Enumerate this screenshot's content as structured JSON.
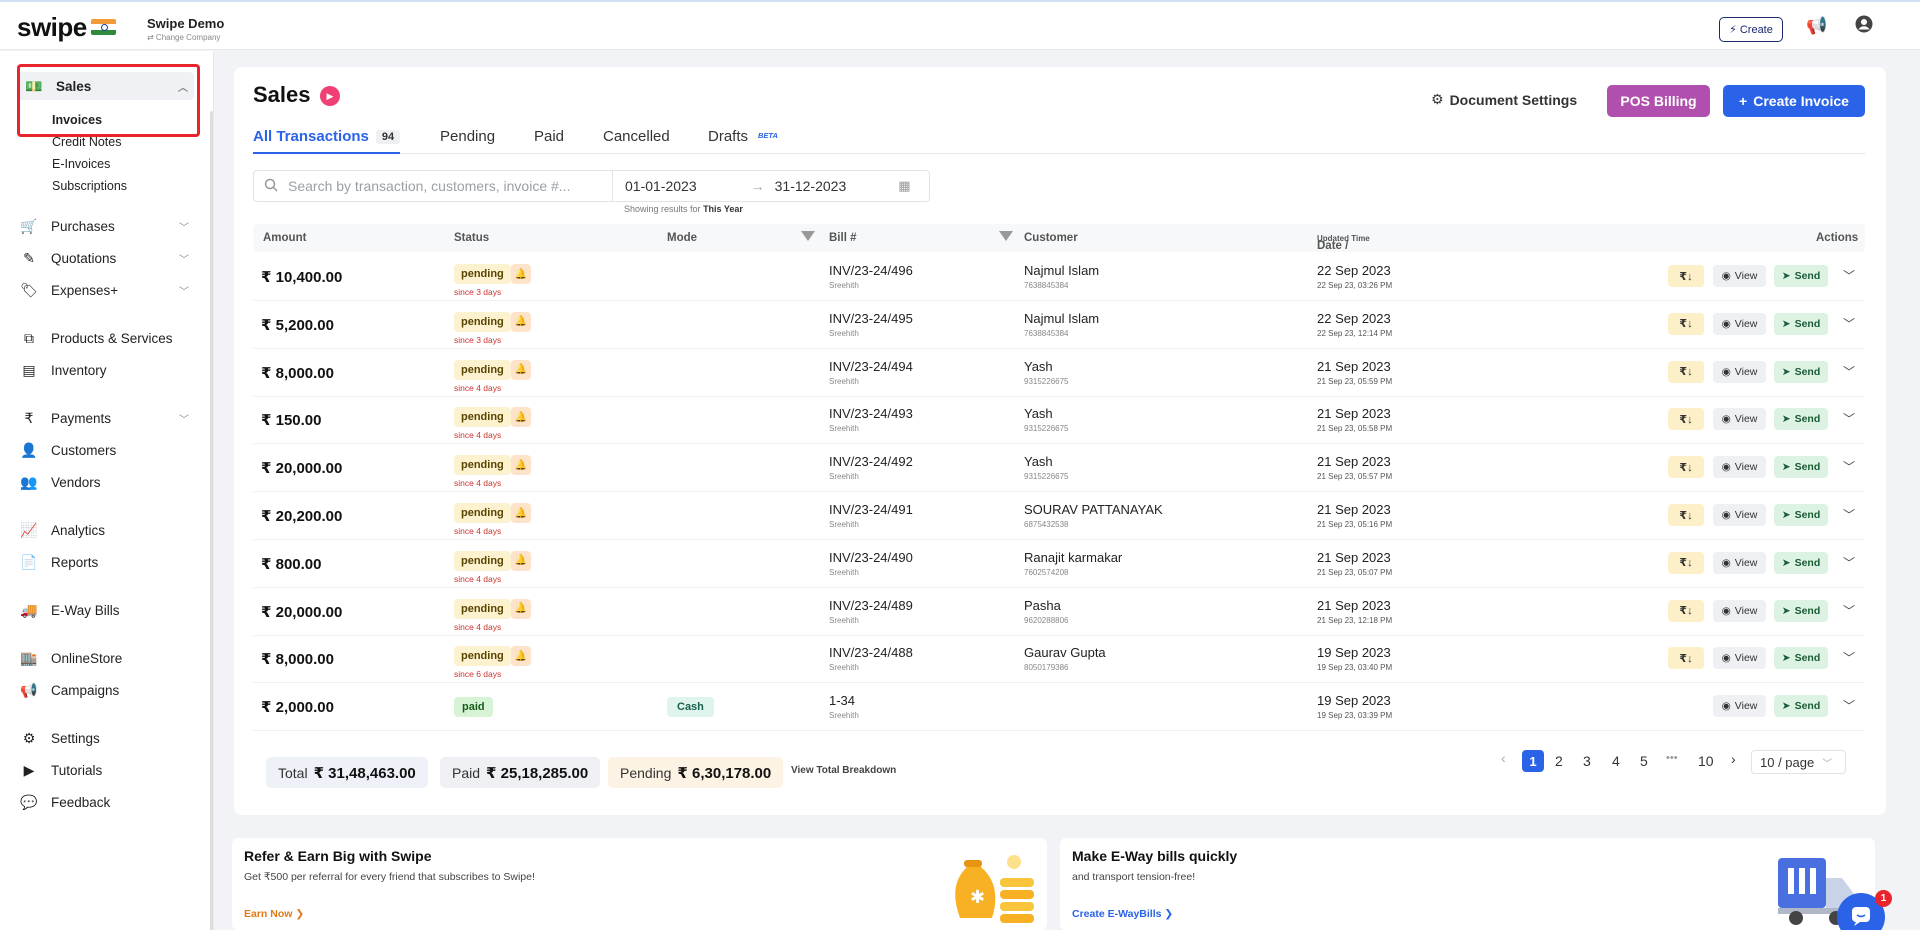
{
  "header": {
    "logo": "swipe",
    "company_name": "Swipe Demo",
    "change_company": "⇄ Change Company",
    "create_label": "Create"
  },
  "sidebar": {
    "sales_label": "Sales",
    "sales_sub": [
      "Invoices",
      "Credit Notes",
      "E-Invoices",
      "Subscriptions"
    ],
    "items": [
      {
        "label": "Purchases",
        "icon": "cart-icon"
      },
      {
        "label": "Quotations",
        "icon": "pen-icon"
      },
      {
        "label": "Expenses+",
        "icon": "tag-icon"
      },
      {
        "label": "Products & Services",
        "icon": "barcode-icon"
      },
      {
        "label": "Inventory",
        "icon": "inventory-icon"
      },
      {
        "label": "Payments",
        "icon": "rupee-icon"
      },
      {
        "label": "Customers",
        "icon": "user-icon"
      },
      {
        "label": "Vendors",
        "icon": "users-icon"
      },
      {
        "label": "Analytics",
        "icon": "chart-icon"
      },
      {
        "label": "Reports",
        "icon": "report-icon"
      },
      {
        "label": "E-Way Bills",
        "icon": "truck-icon"
      },
      {
        "label": "OnlineStore",
        "icon": "store-icon"
      },
      {
        "label": "Campaigns",
        "icon": "megaphone-icon"
      },
      {
        "label": "Settings",
        "icon": "gear-icon"
      },
      {
        "label": "Tutorials",
        "icon": "youtube-icon"
      },
      {
        "label": "Feedback",
        "icon": "comment-icon"
      }
    ]
  },
  "page": {
    "title": "Sales",
    "doc_settings": "Document Settings",
    "pos_billing": "POS Billing",
    "create_invoice": "Create Invoice"
  },
  "tabs": [
    {
      "label": "All Transactions",
      "count": "94"
    },
    {
      "label": "Pending"
    },
    {
      "label": "Paid"
    },
    {
      "label": "Cancelled"
    },
    {
      "label": "Drafts",
      "badge": "BETA"
    }
  ],
  "filters": {
    "search_placeholder": "Search by transaction, customers, invoice #...",
    "date_from": "01-01-2023",
    "date_to": "31-12-2023",
    "showing_prefix": "Showing results for",
    "showing_period": "This Year"
  },
  "table": {
    "headers": {
      "amount": "Amount",
      "status": "Status",
      "mode": "Mode",
      "bill": "Bill #",
      "customer": "Customer",
      "date": "Date /",
      "date_sub": "Updated Time",
      "actions": "Actions"
    },
    "action_labels": {
      "download": "₹↓",
      "view": "View",
      "send": "Send"
    },
    "rows": [
      {
        "amount": "₹ 10,400.00",
        "status": "pending",
        "since": "since 3 days",
        "mode": "",
        "bill": "INV/23-24/496",
        "bill_sub": "Sreehith",
        "customer": "Najmul Islam",
        "phone": "7638845384",
        "date": "22 Sep 2023",
        "time": "22 Sep 23, 03:26 PM"
      },
      {
        "amount": "₹ 5,200.00",
        "status": "pending",
        "since": "since 3 days",
        "mode": "",
        "bill": "INV/23-24/495",
        "bill_sub": "Sreehith",
        "customer": "Najmul Islam",
        "phone": "7638845384",
        "date": "22 Sep 2023",
        "time": "22 Sep 23, 12:14 PM"
      },
      {
        "amount": "₹ 8,000.00",
        "status": "pending",
        "since": "since 4 days",
        "mode": "",
        "bill": "INV/23-24/494",
        "bill_sub": "Sreehith",
        "customer": "Yash",
        "phone": "9315226675",
        "date": "21 Sep 2023",
        "time": "21 Sep 23, 05:59 PM"
      },
      {
        "amount": "₹ 150.00",
        "status": "pending",
        "since": "since 4 days",
        "mode": "",
        "bill": "INV/23-24/493",
        "bill_sub": "Sreehith",
        "customer": "Yash",
        "phone": "9315226675",
        "date": "21 Sep 2023",
        "time": "21 Sep 23, 05:58 PM"
      },
      {
        "amount": "₹ 20,000.00",
        "status": "pending",
        "since": "since 4 days",
        "mode": "",
        "bill": "INV/23-24/492",
        "bill_sub": "Sreehith",
        "customer": "Yash",
        "phone": "9315226675",
        "date": "21 Sep 2023",
        "time": "21 Sep 23, 05:57 PM"
      },
      {
        "amount": "₹ 20,200.00",
        "status": "pending",
        "since": "since 4 days",
        "mode": "",
        "bill": "INV/23-24/491",
        "bill_sub": "Sreehith",
        "customer": "SOURAV PATTANAYAK",
        "phone": "6875432538",
        "date": "21 Sep 2023",
        "time": "21 Sep 23, 05:16 PM"
      },
      {
        "amount": "₹ 800.00",
        "status": "pending",
        "since": "since 4 days",
        "mode": "",
        "bill": "INV/23-24/490",
        "bill_sub": "Sreehith",
        "customer": "Ranajit karmakar",
        "phone": "7602574208",
        "date": "21 Sep 2023",
        "time": "21 Sep 23, 05:07 PM"
      },
      {
        "amount": "₹ 20,000.00",
        "status": "pending",
        "since": "since 4 days",
        "mode": "",
        "bill": "INV/23-24/489",
        "bill_sub": "Sreehith",
        "customer": "Pasha",
        "phone": "9620288806",
        "date": "21 Sep 2023",
        "time": "21 Sep 23, 12:18 PM"
      },
      {
        "amount": "₹ 8,000.00",
        "status": "pending",
        "since": "since 6 days",
        "mode": "",
        "bill": "INV/23-24/488",
        "bill_sub": "Sreehith",
        "customer": "Gaurav Gupta",
        "phone": "8050179386",
        "date": "19 Sep 2023",
        "time": "19 Sep 23, 03:40 PM"
      },
      {
        "amount": "₹ 2,000.00",
        "status": "paid",
        "since": "",
        "mode": "Cash",
        "bill": "1-34",
        "bill_sub": "Sreehith",
        "customer": "",
        "phone": "",
        "date": "19 Sep 2023",
        "time": "19 Sep 23, 03:39 PM"
      }
    ]
  },
  "totals": {
    "total_label": "Total",
    "total": "₹ 31,48,463.00",
    "paid_label": "Paid",
    "paid": "₹ 25,18,285.00",
    "pending_label": "Pending",
    "pending": "₹ 6,30,178.00",
    "breakdown": "View Total Breakdown"
  },
  "pagination": {
    "pages": [
      "1",
      "2",
      "3",
      "4",
      "5",
      "•••",
      "10"
    ],
    "per_page": "10 / page"
  },
  "promos": [
    {
      "title": "Refer & Earn Big with Swipe",
      "desc": "Get ₹500 per referral for every friend that subscribes to Swipe!",
      "link": "Earn Now ❯"
    },
    {
      "title": "Make E-Way bills quickly",
      "desc": "and transport tension-free!",
      "link": "Create E-WayBills ❯"
    }
  ],
  "chat_badge": "1",
  "colors": {
    "primary": "#2a63e8",
    "pos": "#b04fae",
    "highlight": "#e8252c"
  }
}
